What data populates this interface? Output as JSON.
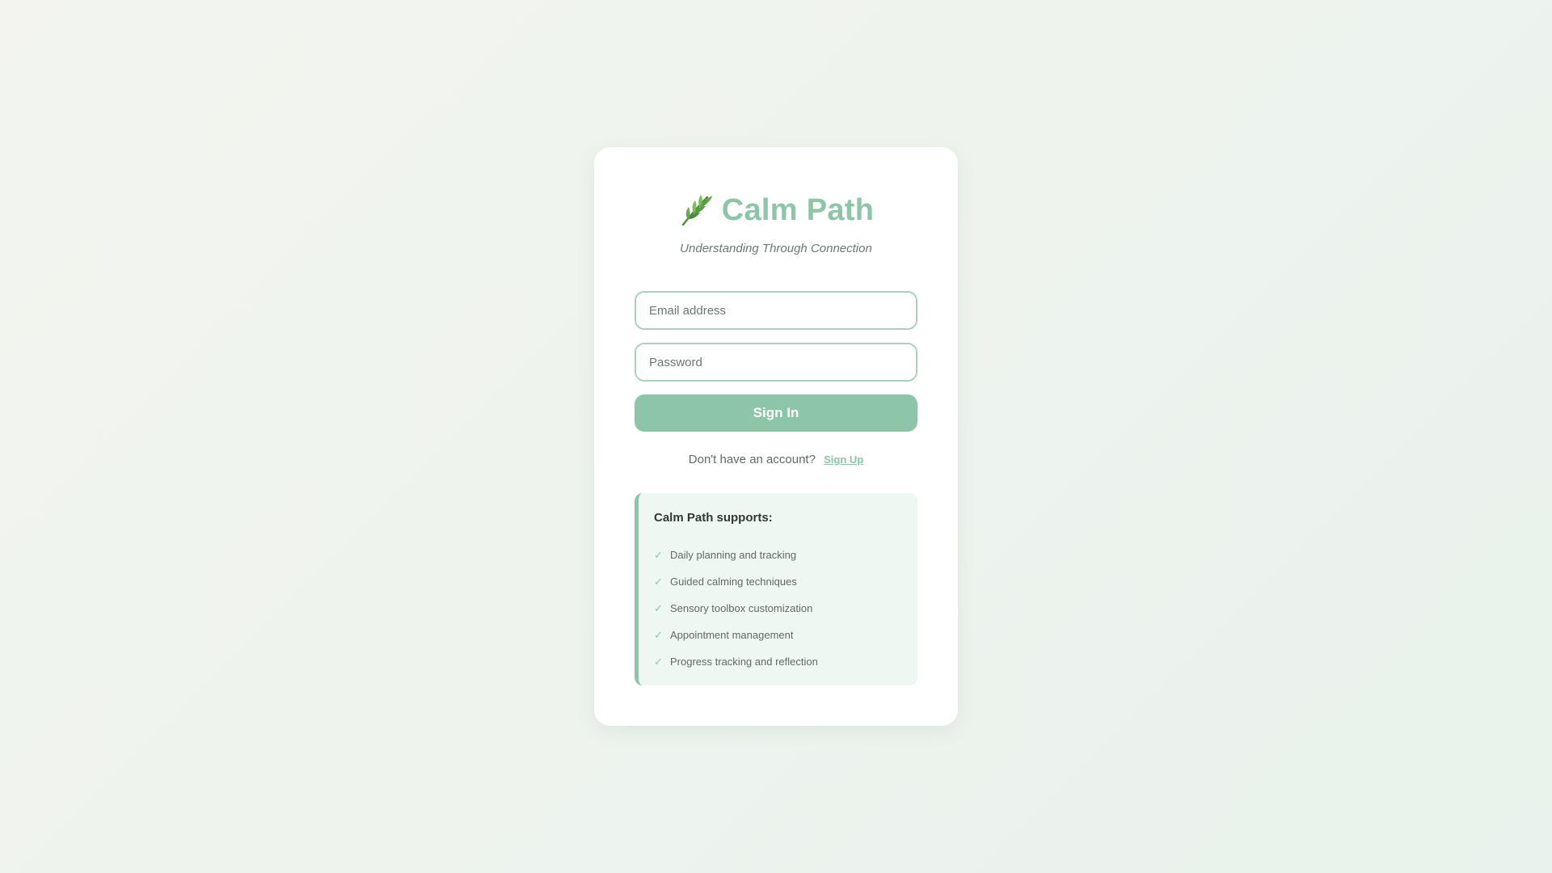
{
  "brand": {
    "icon": "leaf-icon",
    "title": "Calm Path",
    "tagline": "Understanding Through Connection",
    "accent_color": "#8cc5a8"
  },
  "login_form": {
    "email_placeholder": "Email address",
    "email_value": "",
    "password_placeholder": "Password",
    "password_value": "",
    "signin_label": "Sign In"
  },
  "signup": {
    "prompt": "Don't have an account?",
    "link_label": "Sign Up"
  },
  "features": {
    "heading": "Calm Path supports:",
    "check_icon": "check-icon",
    "items": [
      {
        "label": "Daily planning and tracking"
      },
      {
        "label": "Guided calming techniques"
      },
      {
        "label": "Sensory toolbox customization"
      },
      {
        "label": "Appointment management"
      },
      {
        "label": "Progress tracking and reflection"
      }
    ]
  }
}
